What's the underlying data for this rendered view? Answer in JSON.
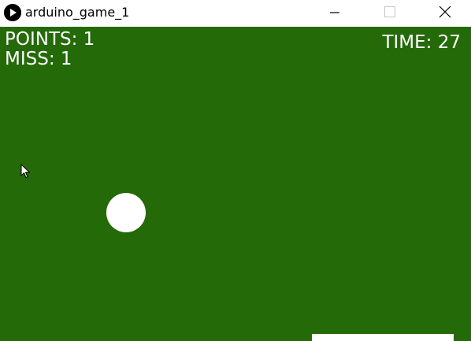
{
  "window": {
    "title": "arduino_game_1"
  },
  "hud": {
    "points_label": "POINTS: 1",
    "miss_label": "MISS: 1",
    "time_label": "TIME: 27"
  },
  "colors": {
    "canvas_background": "#246a08",
    "foreground": "#ffffff"
  },
  "icons": {
    "app": "play-icon",
    "minimize": "minimize-icon",
    "maximize": "maximize-icon",
    "close": "close-icon",
    "pointer": "mouse-pointer-icon"
  }
}
